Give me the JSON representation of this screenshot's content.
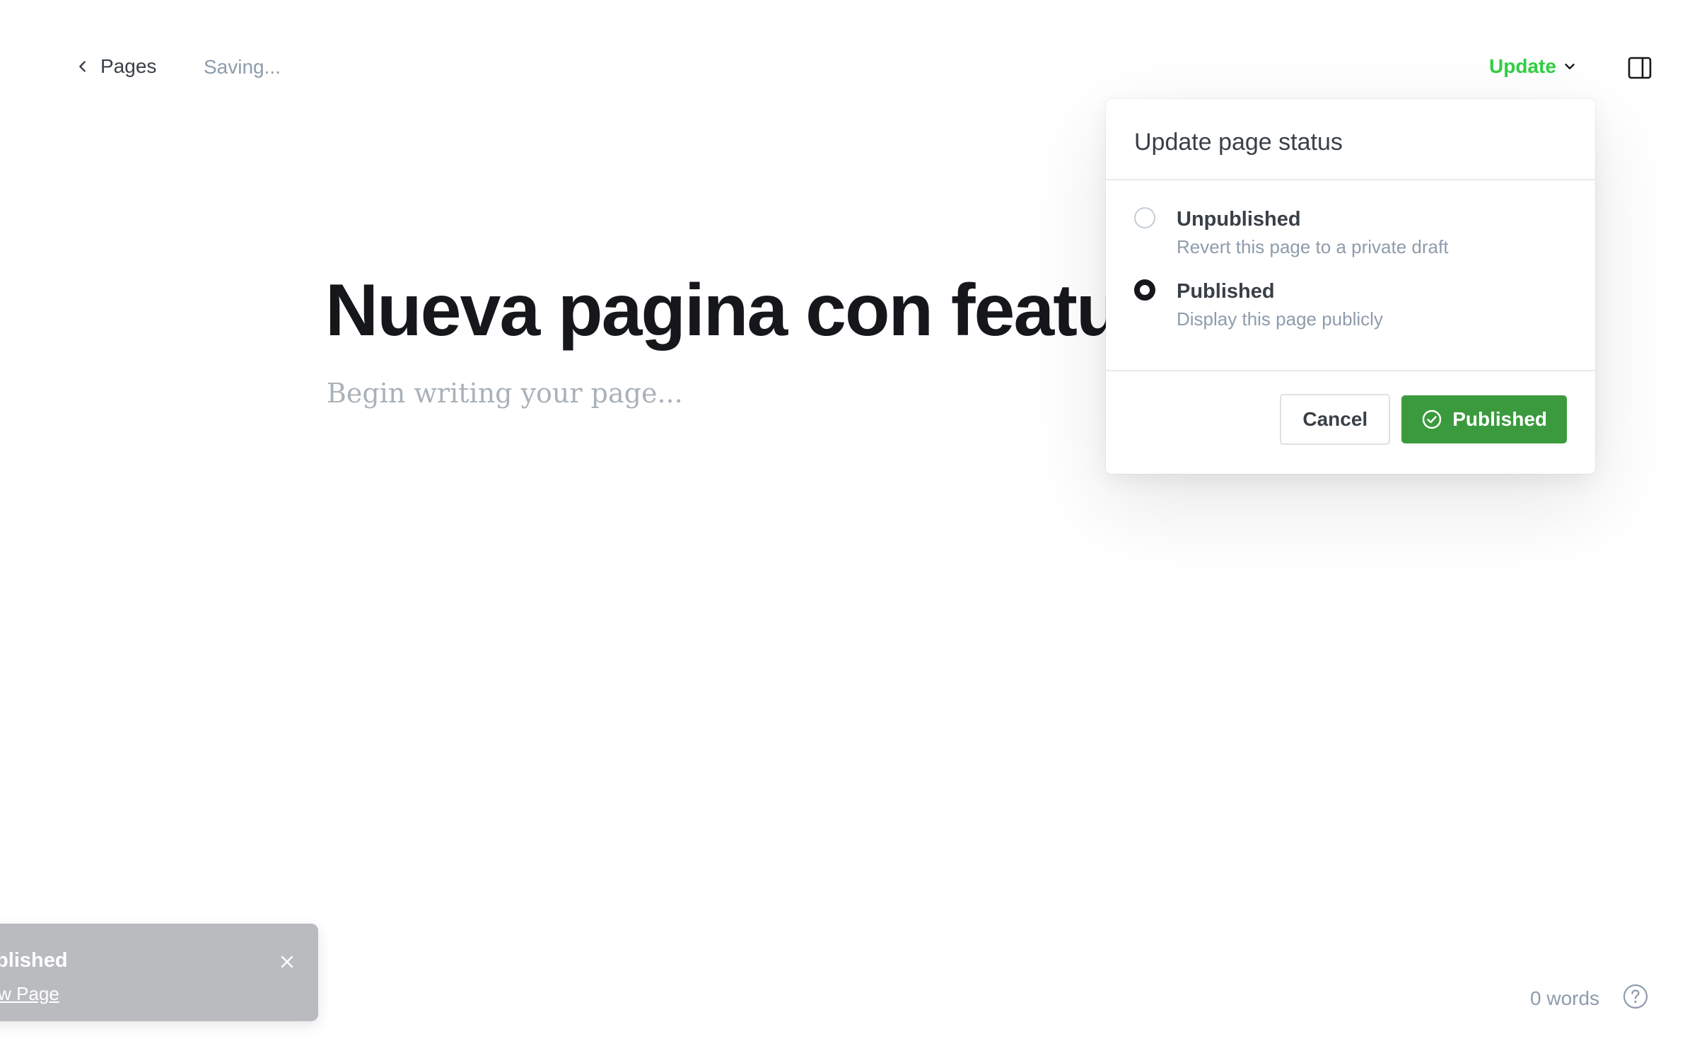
{
  "header": {
    "back_label": "Pages",
    "status_text": "Saving...",
    "update_label": "Update",
    "sidebar_toggle_icon": "sidebar-panel-icon"
  },
  "editor": {
    "title": "Nueva pagina con feature",
    "body_placeholder": "Begin writing your page..."
  },
  "popover": {
    "heading": "Update page status",
    "options": [
      {
        "label": "Unpublished",
        "description": "Revert this page to a private draft",
        "selected": false
      },
      {
        "label": "Published",
        "description": "Display this page publicly",
        "selected": true
      }
    ],
    "cancel_label": "Cancel",
    "confirm_label": "Published"
  },
  "toast": {
    "title": "Published",
    "link_text": "View Page"
  },
  "footer": {
    "word_count": "0 words",
    "help_icon": "question-circle-icon"
  },
  "colors": {
    "accent_green": "#30cf43",
    "button_green": "#3c9a3e",
    "toast_bg": "#b9bbbe"
  }
}
